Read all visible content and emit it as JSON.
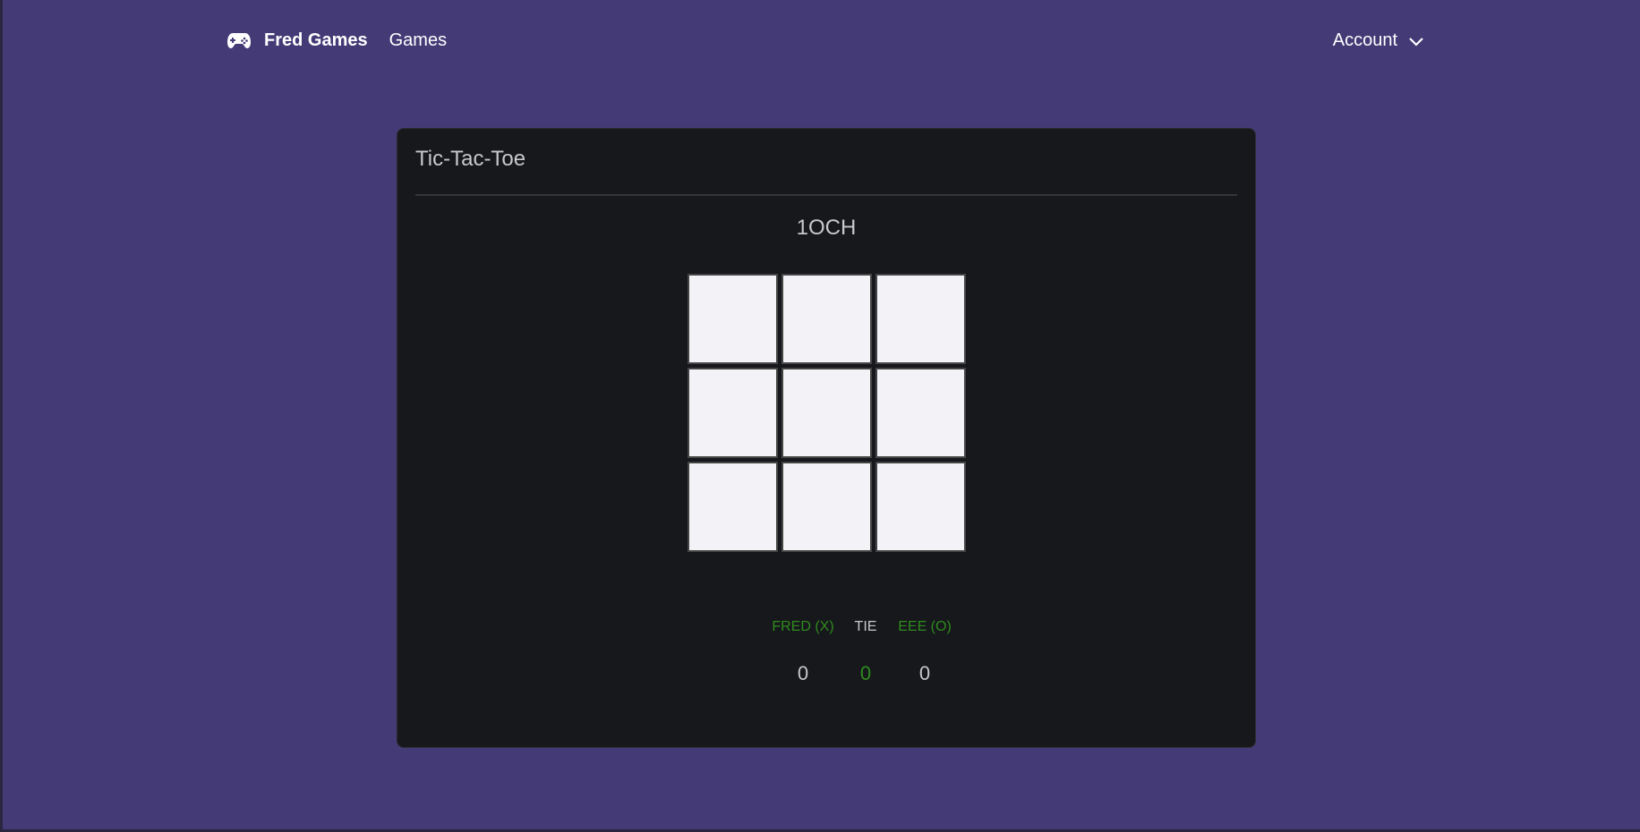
{
  "navbar": {
    "brand": "Fred Games",
    "brand_icon": "gamepad-icon",
    "links": [
      "Games"
    ],
    "account_label": "Account",
    "account_icon": "chevron-down-icon"
  },
  "card": {
    "title": "Tic-Tac-Toe",
    "game_code": "1OCH"
  },
  "board": {
    "cells": [
      "",
      "",
      "",
      "",
      "",
      "",
      "",
      "",
      ""
    ]
  },
  "scoreboard": {
    "player_x": {
      "label": "FRED (X)",
      "value": "0",
      "label_color": "#2e8b1f",
      "value_color": "#c6c8cc"
    },
    "tie": {
      "label": "TIE",
      "value": "0",
      "label_color": "#c6c8cc",
      "value_color": "#2e8b1f"
    },
    "player_o": {
      "label": "EEE (O)",
      "value": "0",
      "label_color": "#2e8b1f",
      "value_color": "#c6c8cc"
    }
  },
  "colors": {
    "page_background": "#443a76",
    "card_background": "#17181b",
    "cell_background": "#f3f3f7",
    "accent_green": "#2e8b1f"
  }
}
